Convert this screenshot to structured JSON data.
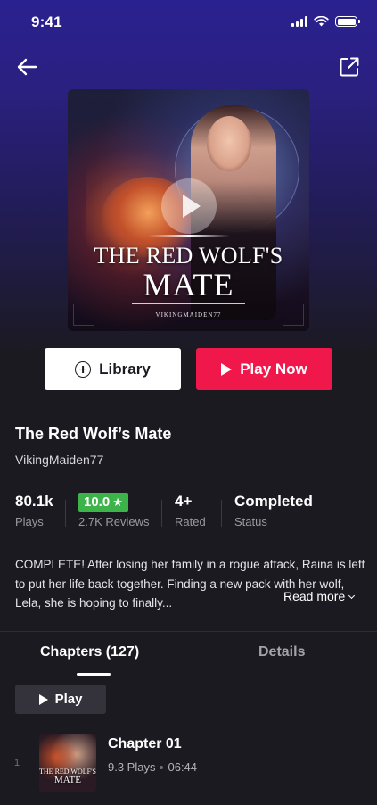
{
  "status_bar": {
    "time": "9:41"
  },
  "cover": {
    "title_line1": "THE RED WOLF'S",
    "title_line2": "MATE",
    "author": "VIKINGMAIDEN77"
  },
  "actions": {
    "library_label": "Library",
    "play_now_label": "Play Now"
  },
  "book": {
    "title": "The Red Wolf’s Mate",
    "author": "VikingMaiden77"
  },
  "stats": {
    "plays_value": "80.1k",
    "plays_label": "Plays",
    "rating_value": "10.0",
    "rating_star": "★",
    "reviews_label": "2.7K Reviews",
    "age_value": "4+",
    "age_label": "Rated",
    "status_value": "Completed",
    "status_label": "Status"
  },
  "description": {
    "text": "COMPLETE! After losing her family in a rogue attack, Raina is left to put her life back together. Finding a new pack with her wolf, Lela, she is hoping to finally...",
    "read_more": "Read more"
  },
  "tabs": {
    "chapters": "Chapters (127)",
    "details": "Details"
  },
  "play_label": "Play",
  "chapters": [
    {
      "index": "1",
      "title": "Chapter 01",
      "plays": "9.3 Plays",
      "duration": "06:44",
      "thumb_line1": "THE RED WOLF'S",
      "thumb_line2": "MATE"
    }
  ],
  "colors": {
    "accent": "#f0184b",
    "rating_green": "#3db44a",
    "background": "#1b1a20",
    "hero_top": "#2a2190"
  }
}
